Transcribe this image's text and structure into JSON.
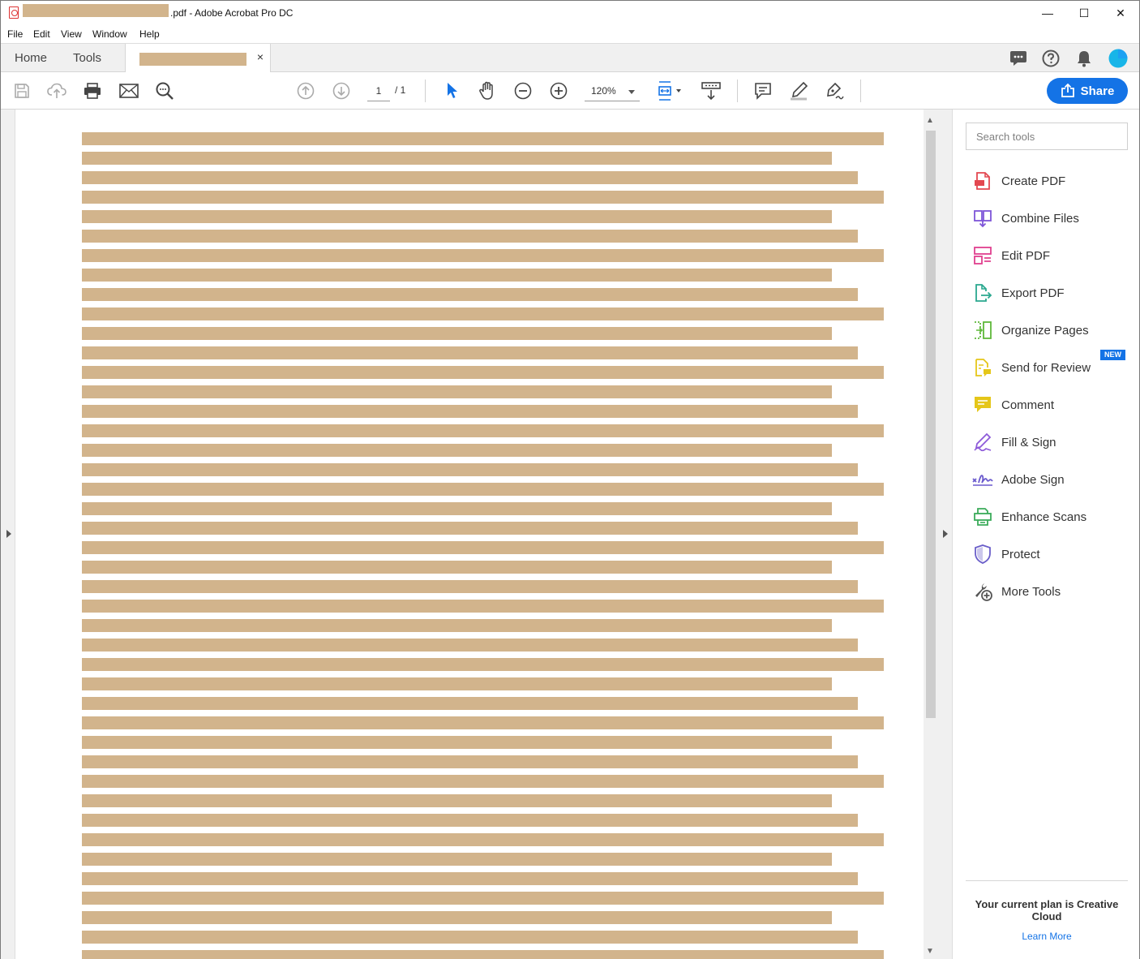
{
  "window": {
    "title_suffix": ".pdf - Adobe Acrobat Pro DC",
    "minimize": "—",
    "maximize": "☐",
    "close": "✕"
  },
  "menu": [
    "File",
    "Edit",
    "View",
    "Window",
    "Help"
  ],
  "tabs": {
    "home": "Home",
    "tools": "Tools",
    "doc_close": "×"
  },
  "toolbar": {
    "page_current": "1",
    "page_total": "/  1",
    "zoom": "120%",
    "share_label": "Share"
  },
  "tools_pane": {
    "search_placeholder": "Search tools",
    "items": [
      {
        "label": "Create PDF",
        "icon": "create-pdf-icon",
        "color": "#e34850"
      },
      {
        "label": "Combine Files",
        "icon": "combine-files-icon",
        "color": "#7e55d8"
      },
      {
        "label": "Edit PDF",
        "icon": "edit-pdf-icon",
        "color": "#e0408f"
      },
      {
        "label": "Export PDF",
        "icon": "export-pdf-icon",
        "color": "#2aa88f"
      },
      {
        "label": "Organize Pages",
        "icon": "organize-pages-icon",
        "color": "#5fb83a"
      },
      {
        "label": "Send for Review",
        "icon": "send-for-review-icon",
        "color": "#e5c619"
      },
      {
        "label": "Comment",
        "icon": "comment-icon",
        "color": "#e5c619"
      },
      {
        "label": "Fill & Sign",
        "icon": "fill-sign-icon",
        "color": "#8e5bd9"
      },
      {
        "label": "Adobe Sign",
        "icon": "adobe-sign-icon",
        "color": "#6a5acd"
      },
      {
        "label": "Enhance Scans",
        "icon": "enhance-scans-icon",
        "color": "#3bab5a"
      },
      {
        "label": "Protect",
        "icon": "protect-icon",
        "color": "#6a5ec9"
      },
      {
        "label": "More Tools",
        "icon": "more-tools-icon",
        "color": "#555555"
      }
    ],
    "new_badge": "NEW",
    "plan_text": "Your current plan is Creative Cloud",
    "learn_more": "Learn More"
  },
  "colors": {
    "accent": "#1473e6",
    "redaction": "#d2b48c"
  }
}
